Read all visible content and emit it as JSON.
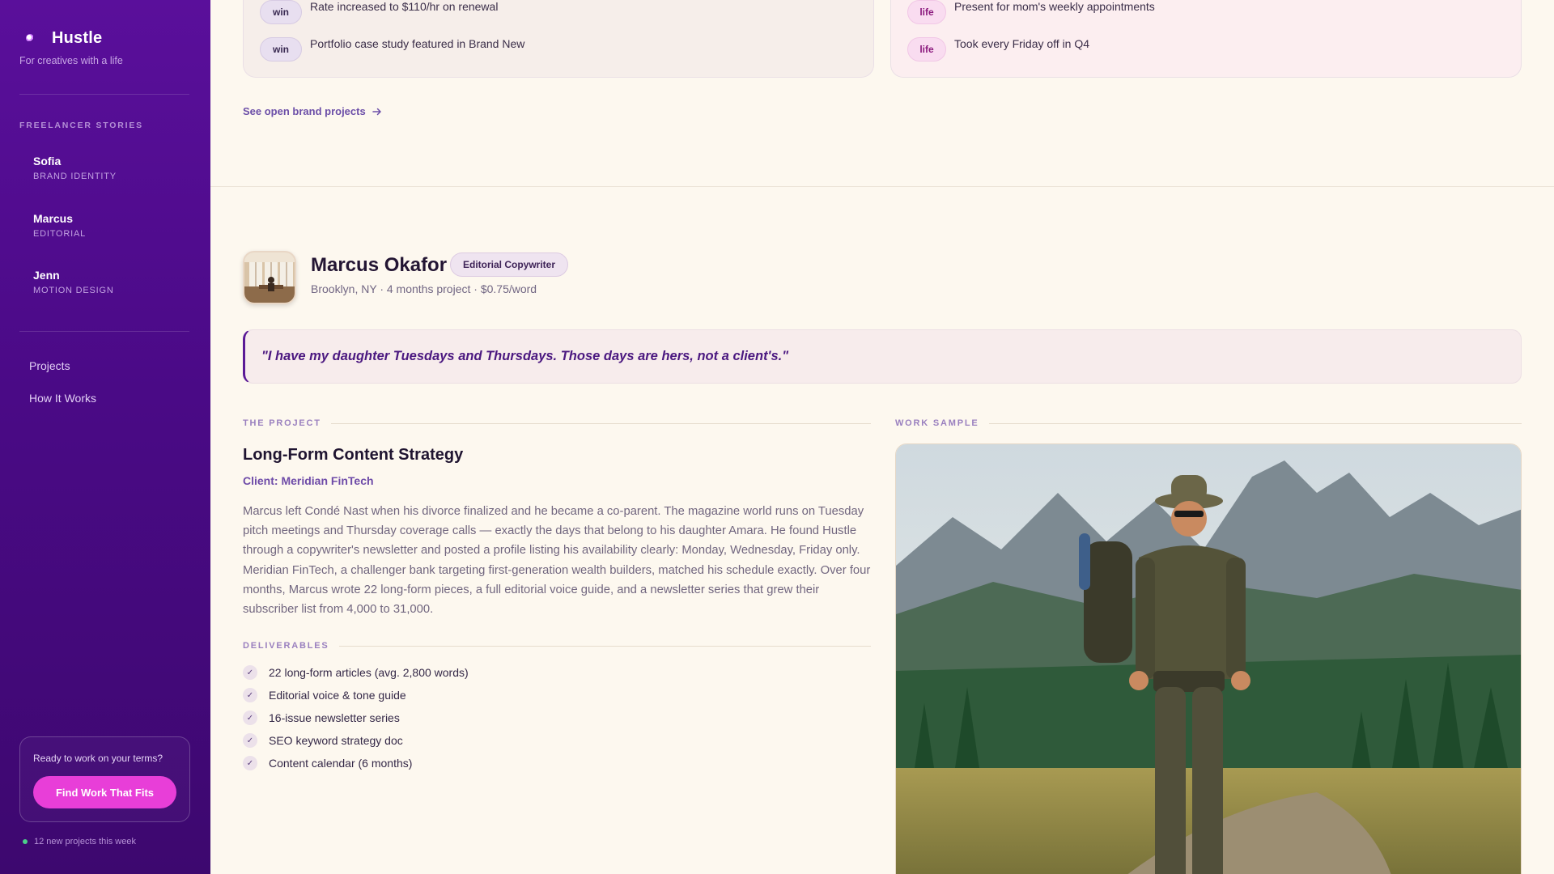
{
  "sidebar": {
    "brand": "Hustle",
    "tagline": "For creatives with a life",
    "section_label": "FREELANCER STORIES",
    "stories": [
      {
        "name": "Sofia",
        "role": "BRAND IDENTITY"
      },
      {
        "name": "Marcus",
        "role": "EDITORIAL"
      },
      {
        "name": "Jenn",
        "role": "MOTION DESIGN"
      }
    ],
    "nav": [
      "Projects",
      "How It Works"
    ],
    "cta": {
      "text": "Ready to work on your terms?",
      "button": "Find Work That Fits"
    },
    "new_projects": "12 new projects this week"
  },
  "previous": {
    "wins": [
      {
        "tag": "win",
        "text": "Rate increased to $110/hr on renewal"
      },
      {
        "tag": "win",
        "text": "Portfolio case study featured in Brand New"
      }
    ],
    "life": [
      {
        "tag": "life",
        "text": "Present for mom's weekly appointments"
      },
      {
        "tag": "life",
        "text": "Took every Friday off in Q4"
      }
    ],
    "link": "See open brand projects"
  },
  "profile": {
    "name": "Marcus Okafor",
    "role": "Editorial Copywriter",
    "meta": "Brooklyn, NY · 4 months project · $0.75/word",
    "quote": "\"I have my daughter Tuesdays and Thursdays. Those days are hers, not a client's.\""
  },
  "project": {
    "label": "THE PROJECT",
    "title": "Long-Form Content Strategy",
    "client": "Client: Meridian FinTech",
    "description": "Marcus left Condé Nast when his divorce finalized and he became a co-parent. The magazine world runs on Tuesday pitch meetings and Thursday coverage calls — exactly the days that belong to his daughter Amara. He found Hustle through a copywriter's newsletter and posted a profile listing his availability clearly: Monday, Wednesday, Friday only. Meridian FinTech, a challenger bank targeting first-generation wealth builders, matched his schedule exactly. Over four months, Marcus wrote 22 long-form pieces, a full editorial voice guide, and a newsletter series that grew their subscriber list from 4,000 to 31,000.",
    "deliverables_label": "DELIVERABLES",
    "deliverables": [
      "22 long-form articles (avg. 2,800 words)",
      "Editorial voice & tone guide",
      "16-issue newsletter series",
      "SEO keyword strategy doc",
      "Content calendar (6 months)"
    ]
  },
  "sample": {
    "label": "WORK SAMPLE"
  },
  "colors": {
    "sidebar": "#4a0a86",
    "accent": "#e83ed8",
    "link": "#6c4fa8",
    "background": "#fdf8ef"
  }
}
